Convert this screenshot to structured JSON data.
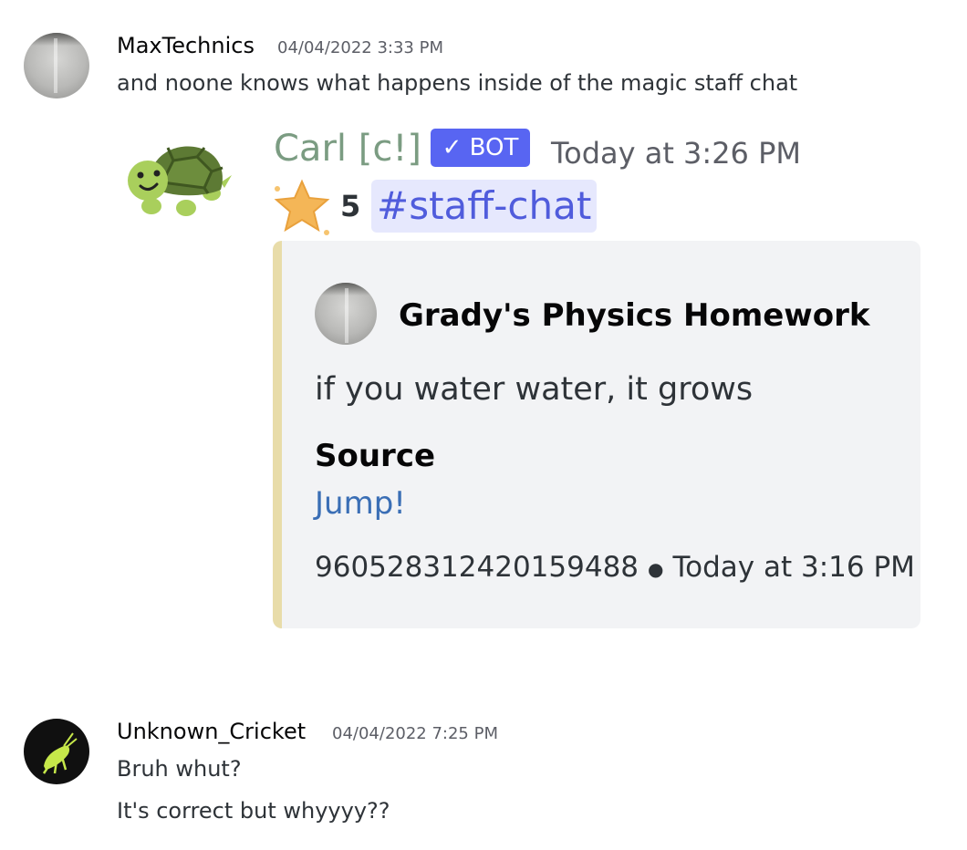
{
  "messages": [
    {
      "username": "MaxTechnics",
      "timestamp": "04/04/2022 3:33 PM",
      "lines": [
        "and noone knows what happens inside of the magic staff chat"
      ]
    },
    {
      "username": "Unknown_Cricket",
      "timestamp": "04/04/2022 7:25 PM",
      "lines": [
        "Bruh whut?",
        "It's correct but whyyyy??"
      ]
    }
  ],
  "bot_message": {
    "username": "Carl [c!]",
    "badge": "✓ BOT",
    "timestamp": "Today at 3:26 PM",
    "avatar_icon": "turtle-icon",
    "star_icon": "star-icon",
    "star_count": "5",
    "channel": "#staff-chat",
    "embed": {
      "accent_color": "#e8dca9",
      "author": "Grady's Physics Homework",
      "description": "if you water water, it grows",
      "field_name": "Source",
      "field_value": "Jump!",
      "footer_id": "960528312420159488",
      "footer_time": "Today at 3:16 PM"
    }
  },
  "colors": {
    "mention_bg": "#e6e8fd",
    "mention_text": "#505cdc",
    "bot_badge": "#5865f2",
    "link": "#3a6eb5"
  }
}
